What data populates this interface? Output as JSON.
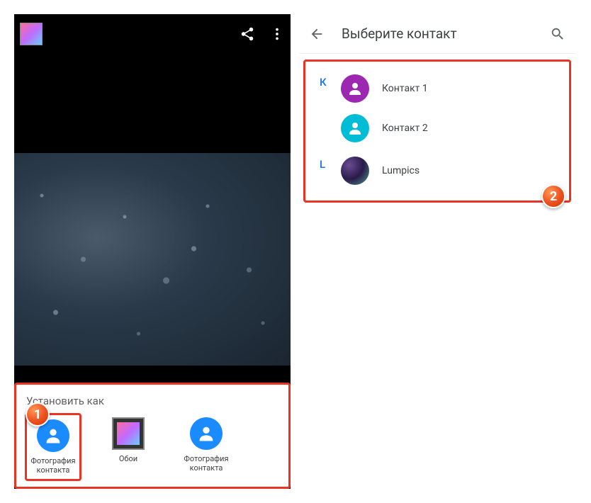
{
  "left": {
    "sheet_title": "Установить как",
    "options": [
      {
        "label": "Фотография контакта",
        "icon": "person"
      },
      {
        "label": "Обои",
        "icon": "gallery"
      },
      {
        "label": "Фотография контакта",
        "icon": "person"
      }
    ]
  },
  "right": {
    "header_title": "Выберите контакт",
    "sections": [
      {
        "letter": "К",
        "contacts": [
          {
            "name": "Контакт 1",
            "avatar_class": "avatar-purple"
          },
          {
            "name": "Контакт 2",
            "avatar_class": "avatar-teal"
          }
        ]
      },
      {
        "letter": "L",
        "contacts": [
          {
            "name": "Lumpics",
            "avatar_class": "avatar-image"
          }
        ]
      }
    ]
  },
  "badges": {
    "one": "1",
    "two": "2"
  }
}
